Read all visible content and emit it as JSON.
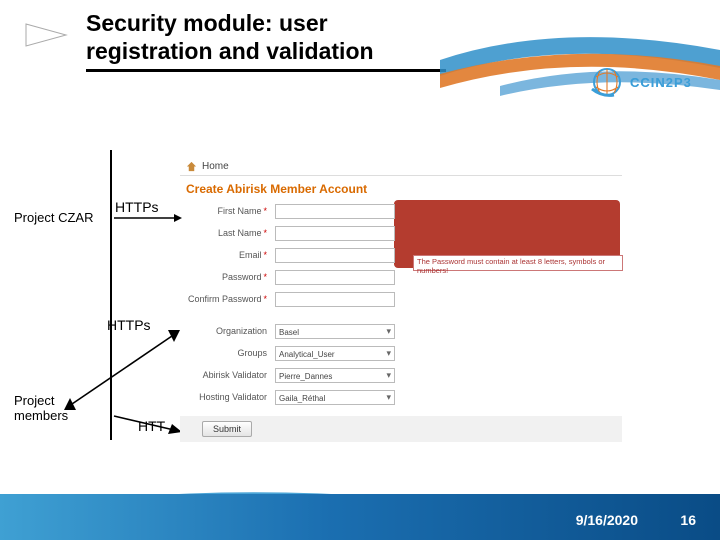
{
  "slide": {
    "title": "Security module: user registration and validation"
  },
  "logo": {
    "text": "CCIN2P3"
  },
  "labels": {
    "czar": "Project CZAR",
    "members_line1": "Project",
    "members_line2": "members",
    "https1": "HTTPs",
    "https2": "HTTPs",
    "http": "HTT"
  },
  "form": {
    "home": "Home",
    "create_title": "Create Abirisk Member Account",
    "first_name": "First Name",
    "last_name": "Last Name",
    "email": "Email",
    "password": "Password",
    "confirm_password": "Confirm Password",
    "organization": "Organization",
    "organization_value": "Basel",
    "groups": "Groups",
    "groups_value": "Analytical_User",
    "abirisk_validator": "Abirisk Validator",
    "abirisk_validator_value": "Pierre_Dannes",
    "hosting_validator": "Hosting Validator",
    "hosting_validator_value": "Gaila_Réthal",
    "submit": "Submit",
    "pw_hint": "The Password must contain at least 8 letters, symbols or numbers!"
  },
  "footer": {
    "date": "9/16/2020",
    "page": "16"
  }
}
